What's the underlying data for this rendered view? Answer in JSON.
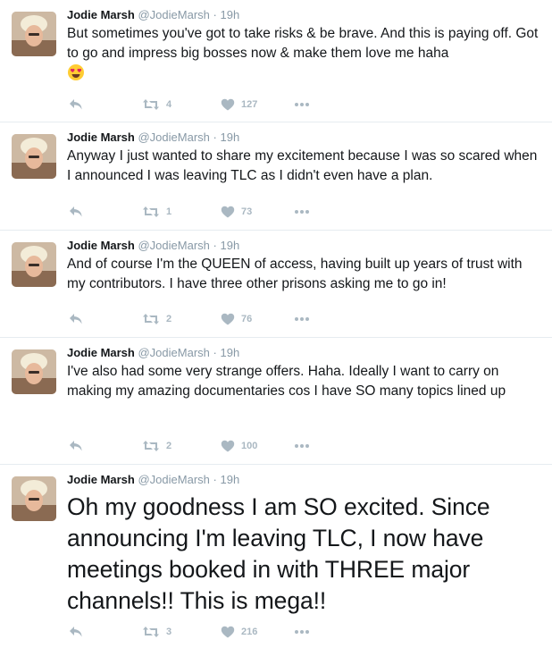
{
  "tweets": [
    {
      "name": "Jodie Marsh",
      "handle": "@JodieMarsh",
      "separator": "·",
      "time": "19h",
      "text": "But sometimes you've got to take risks & be brave. And this is paying off. Got to go and impress big bosses now & make them love me haha",
      "emoji": "heart-eyes-emoji",
      "retweets": "4",
      "likes": "127"
    },
    {
      "name": "Jodie Marsh",
      "handle": "@JodieMarsh",
      "separator": "·",
      "time": "19h",
      "text": "Anyway I just wanted to share my excitement because I was so scared when I announced I was leaving TLC as I didn't even have a plan.",
      "retweets": "1",
      "likes": "73"
    },
    {
      "name": "Jodie Marsh",
      "handle": "@JodieMarsh",
      "separator": "·",
      "time": "19h",
      "text": "And of course I'm the QUEEN of access, having built up years of trust with my contributors. I have three other prisons asking me to go in!",
      "retweets": "2",
      "likes": "76"
    },
    {
      "name": "Jodie Marsh",
      "handle": "@JodieMarsh",
      "separator": "·",
      "time": "19h",
      "text": "I've also had some very strange offers. Haha. Ideally I want to carry on making my amazing documentaries cos I have SO many topics lined up",
      "retweets": "2",
      "likes": "100"
    },
    {
      "name": "Jodie Marsh",
      "handle": "@JodieMarsh",
      "separator": "·",
      "time": "19h",
      "text": "Oh my goodness I am SO excited. Since announcing I'm leaving TLC, I now have meetings booked in with THREE major channels!! This is mega!!",
      "retweets": "3",
      "likes": "216"
    }
  ],
  "icons": {
    "reply": "reply-icon",
    "retweet": "retweet-icon",
    "like": "heart-icon",
    "more": "more-dots-icon"
  },
  "colors": {
    "text": "#14171a",
    "secondary": "#8899a6",
    "action": "#aab8c2",
    "divider": "#e6ecf0"
  }
}
